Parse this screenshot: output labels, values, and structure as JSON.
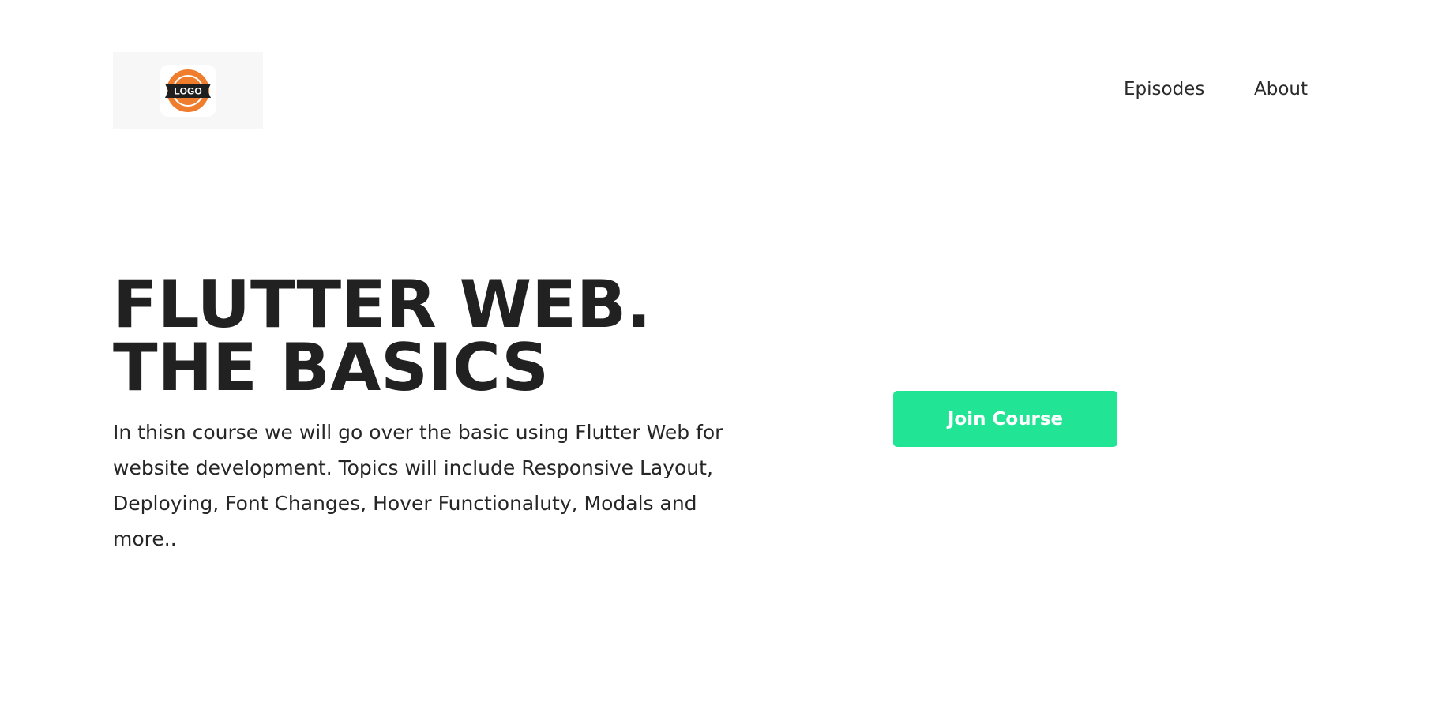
{
  "navbar": {
    "logo_text": "LOGO",
    "items": [
      {
        "label": "Episodes"
      },
      {
        "label": "About"
      }
    ]
  },
  "hero": {
    "title": "FLUTTER WEB.\nTHE BASICS",
    "description": "In thisn course we will go over the basic using Flutter Web for website development. Topics will include Responsive Layout, Deploying, Font Changes, Hover Functionaluty, Modals and more..",
    "cta_label": "Join Course"
  },
  "colors": {
    "accent": "#21e495",
    "text": "#212121",
    "logo_orange": "#f07c2e",
    "logo_background": "#f7f7f7"
  },
  "icons": {
    "logo": "logo-badge-icon"
  }
}
